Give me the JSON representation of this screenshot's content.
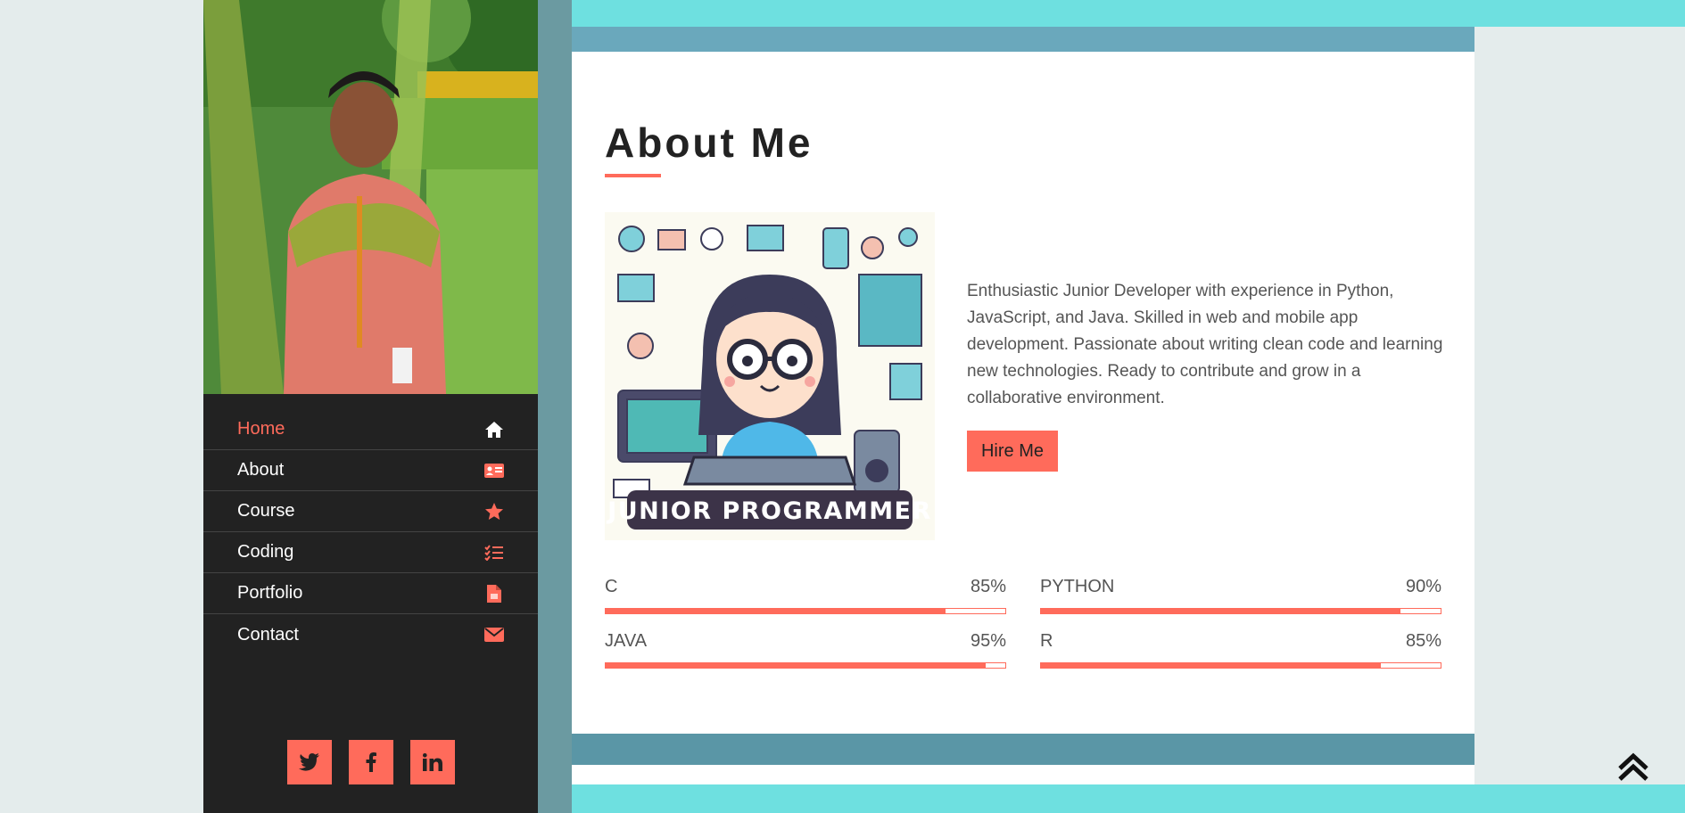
{
  "nav": [
    {
      "label": "Home",
      "icon": "home-icon",
      "active": true
    },
    {
      "label": "About",
      "icon": "id-card-icon",
      "active": false
    },
    {
      "label": "Course",
      "icon": "star-icon",
      "active": false
    },
    {
      "label": "Coding",
      "icon": "list-check-icon",
      "active": false
    },
    {
      "label": "Portfolio",
      "icon": "file-icon",
      "active": false
    },
    {
      "label": "Contact",
      "icon": "envelope-icon",
      "active": false
    }
  ],
  "socials": [
    "twitter-icon",
    "facebook-icon",
    "linkedin-icon"
  ],
  "about": {
    "title": "About Me",
    "illustration_caption": "JUNIOR PROGRAMMER",
    "bio": "Enthusiastic Junior Developer with experience in Python, JavaScript, and Java. Skilled in web and mobile app development. Passionate about writing clean code and learning new technologies. Ready to contribute and grow in a collaborative environment.",
    "hire_button": "Hire Me"
  },
  "skills": [
    {
      "name": "C",
      "percent_label": "85%",
      "value": 0.85
    },
    {
      "name": "PYTHON",
      "percent_label": "90%",
      "value": 0.9
    },
    {
      "name": "JAVA",
      "percent_label": "95%",
      "value": 0.95
    },
    {
      "name": "R",
      "percent_label": "85%",
      "value": 0.85
    }
  ],
  "colors": {
    "accent": "#ff6b5b",
    "sidebar": "#222222",
    "cyan": "#6ee0e0",
    "steel_blue": "#6aa8bc"
  }
}
